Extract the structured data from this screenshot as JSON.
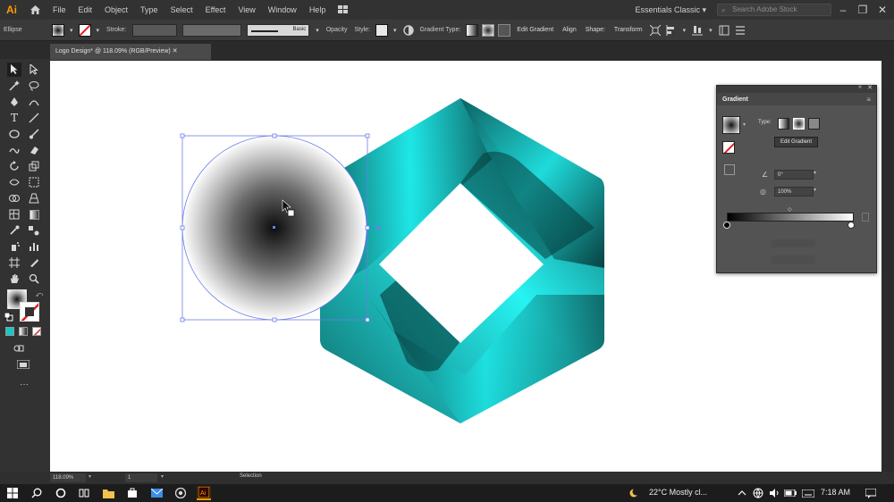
{
  "app": {
    "logo": "Ai",
    "workspace": "Essentials Classic",
    "search_placeholder": "Search Adobe Stock"
  },
  "menu": [
    "File",
    "Edit",
    "Object",
    "Type",
    "Select",
    "Effect",
    "View",
    "Window",
    "Help"
  ],
  "controlbar": {
    "object_type": "Ellipse",
    "stroke_label": "Stroke:",
    "brush_style": "Basic",
    "opacity_label": "Opacity",
    "style_label": "Style:",
    "gradient_type_label": "Gradient Type:",
    "edit_gradient": "Edit Gradient",
    "align": "Align",
    "shape": "Shape:",
    "transform": "Transform"
  },
  "document": {
    "tab_title": "Logo Design* @ 118.09% (RGB/Preview)"
  },
  "gradient_panel": {
    "title": "Gradient",
    "type_label": "Type:",
    "tooltip": "Edit Gradient",
    "angle": "0°",
    "ratio": "100%"
  },
  "statusbar": {
    "zoom": "118.09%",
    "page": "1",
    "tool": "Selection"
  },
  "taskbar": {
    "weather": "22°C  Mostly cl...",
    "time": "7:18 AM"
  },
  "colors": {
    "accent_teal": "#14c9c9",
    "ai_orange": "#ff9a00"
  }
}
